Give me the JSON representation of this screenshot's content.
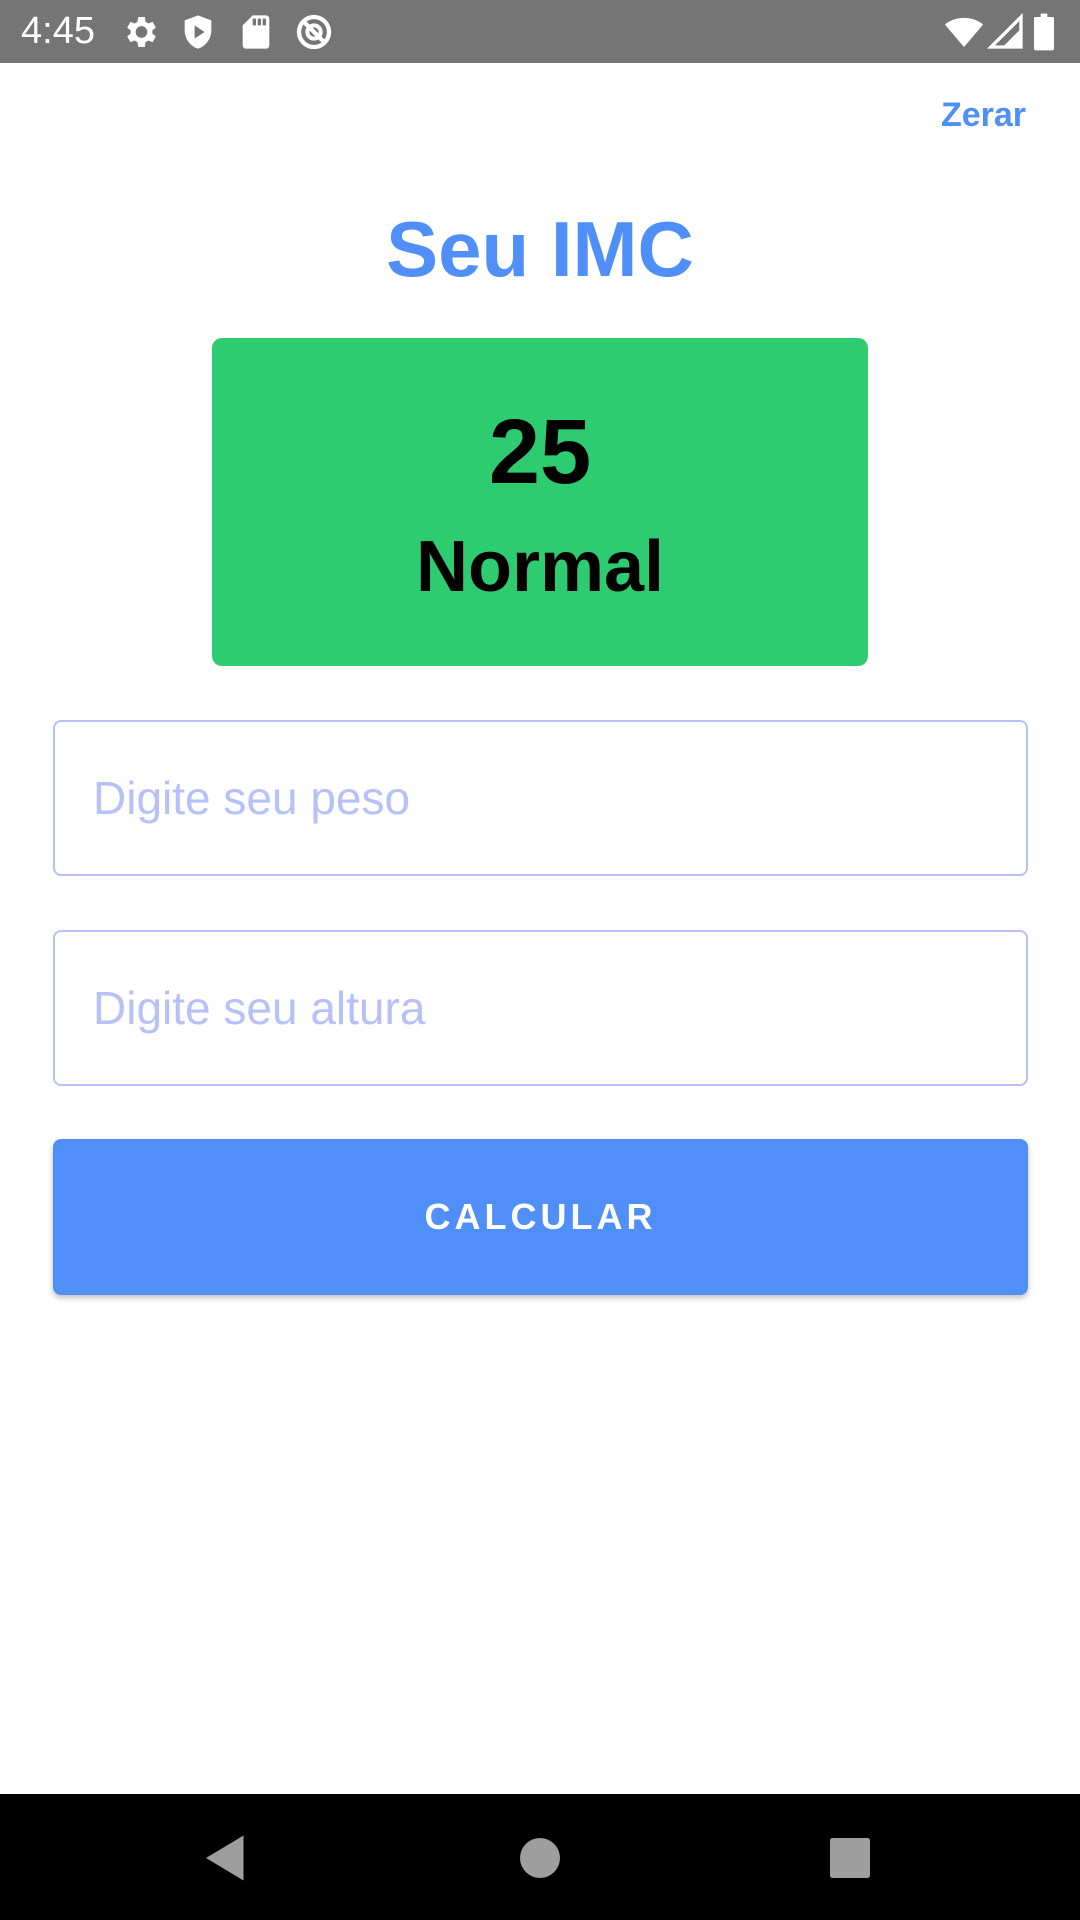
{
  "status_bar": {
    "time": "4:45",
    "left_icons": [
      "gear-icon",
      "shield-play-icon",
      "sd-card-icon",
      "do-not-disturb-icon"
    ],
    "right_icons": [
      "wifi-icon",
      "cell-signal-icon",
      "battery-icon"
    ],
    "background": "#757575"
  },
  "header": {
    "reset_label": "Zerar"
  },
  "main": {
    "title": "Seu IMC",
    "result": {
      "value": "25",
      "classification": "Normal",
      "color": "#2ecc71"
    },
    "weight_input": {
      "placeholder": "Digite seu peso",
      "value": ""
    },
    "height_input": {
      "placeholder": "Digite seu altura",
      "value": ""
    },
    "calculate_label": "CALCULAR"
  },
  "navigation": {
    "buttons": [
      "back-icon",
      "home-icon",
      "recents-icon"
    ]
  },
  "colors": {
    "accent": "#4f8ff7",
    "input_border": "#b6c1f7"
  }
}
